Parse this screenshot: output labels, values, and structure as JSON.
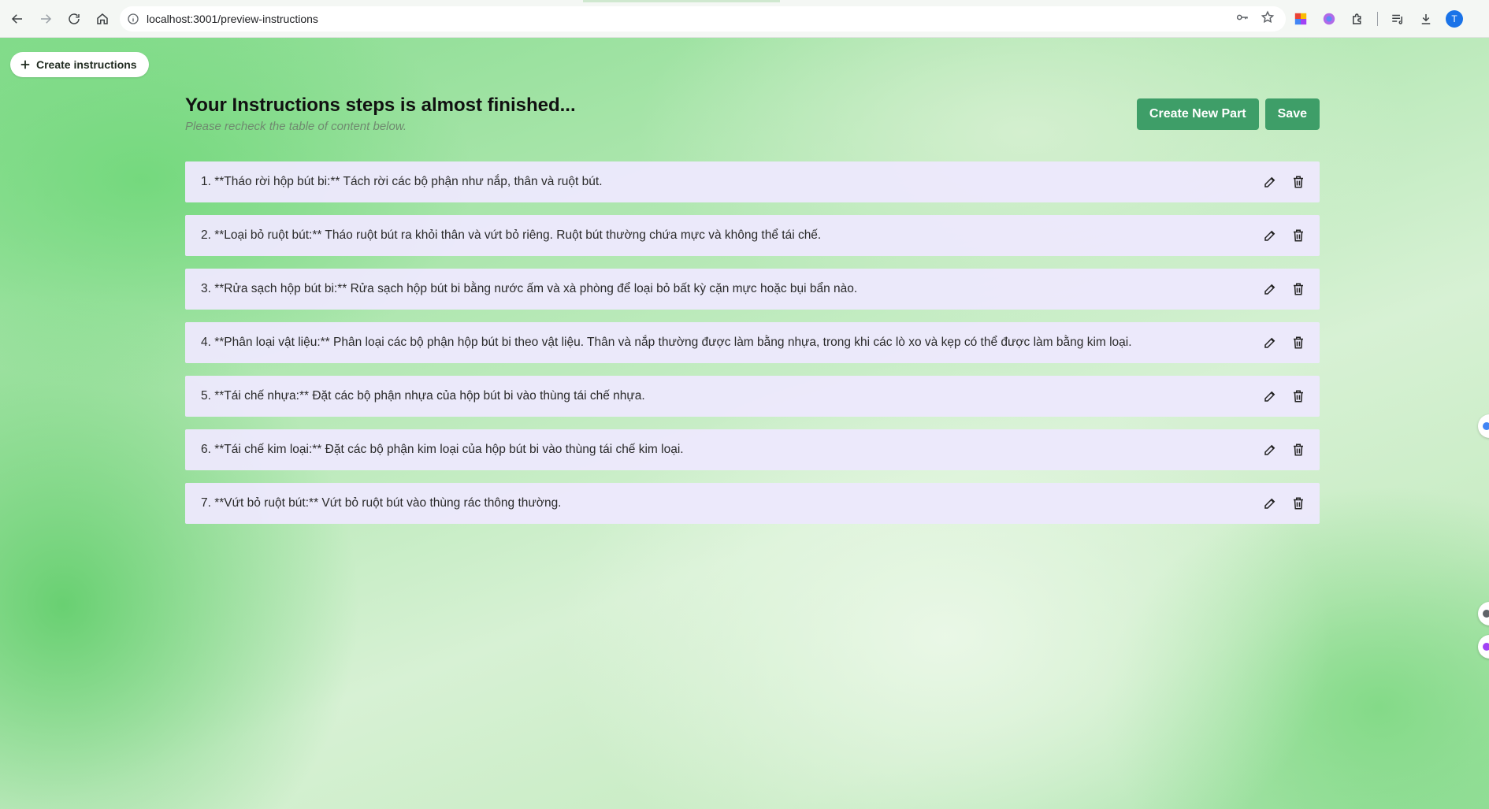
{
  "browser": {
    "url": "localhost:3001/preview-instructions",
    "profile_initial": "T"
  },
  "page": {
    "create_instructions_label": "Create instructions",
    "heading": "Your Instructions steps is almost finished...",
    "subheading": "Please recheck the table of content below.",
    "create_new_part_label": "Create New Part",
    "save_label": "Save",
    "steps": [
      "1. **Tháo rời hộp bút bi:** Tách rời các bộ phận như nắp, thân và ruột bút.",
      "2. **Loại bỏ ruột bút:** Tháo ruột bút ra khỏi thân và vứt bỏ riêng. Ruột bút thường chứa mực và không thể tái chế.",
      "3. **Rửa sạch hộp bút bi:** Rửa sạch hộp bút bi bằng nước ấm và xà phòng để loại bỏ bất kỳ cặn mực hoặc bụi bẩn nào.",
      "4. **Phân loại vật liệu:** Phân loại các bộ phận hộp bút bi theo vật liệu. Thân và nắp thường được làm bằng nhựa, trong khi các lò xo và kẹp có thể được làm bằng kim loại.",
      "5. **Tái chế nhựa:** Đặt các bộ phận nhựa của hộp bút bi vào thùng tái chế nhựa.",
      "6. **Tái chế kim loại:** Đặt các bộ phận kim loại của hộp bút bi vào thùng tái chế kim loại.",
      "7. **Vứt bỏ ruột bút:** Vứt bỏ ruột bút vào thùng rác thông thường."
    ]
  },
  "icons": {
    "back": "arrow-left-icon",
    "forward": "arrow-right-icon",
    "reload": "reload-icon",
    "home": "home-icon",
    "edit": "pencil-icon",
    "delete": "trash-icon",
    "plus": "plus-icon"
  },
  "colors": {
    "primary_button": "#3e9e68",
    "list_item_bg": "#ece8fc"
  }
}
